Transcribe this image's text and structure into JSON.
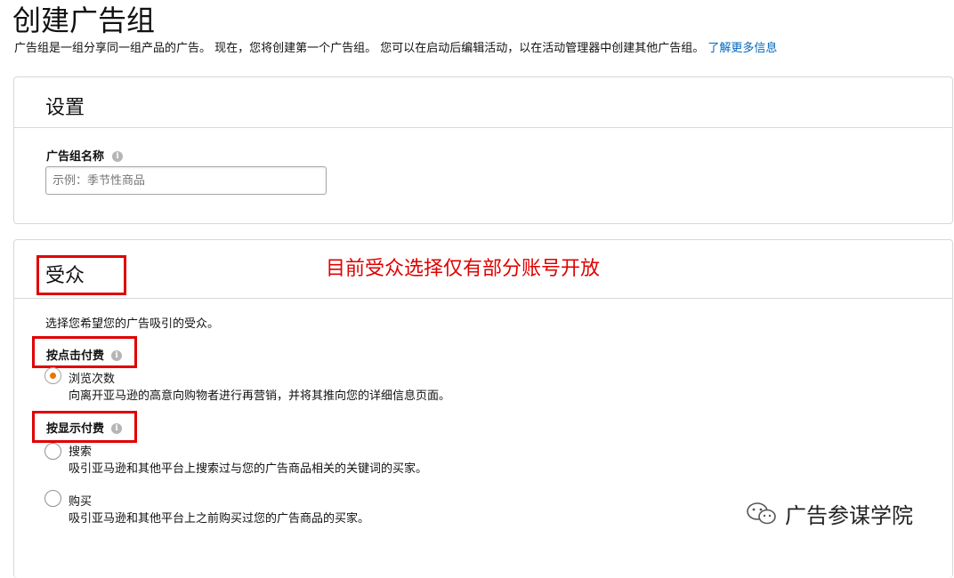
{
  "header": {
    "title": "创建广告组",
    "subtitle": "广告组是一组分享同一组产品的广告。 现在，您将创建第一个广告组。 您可以在启动后编辑活动，以在活动管理器中创建其他广告组。",
    "learn_more": "了解更多信息"
  },
  "settings": {
    "title": "设置",
    "name_label": "广告组名称",
    "name_value": "",
    "name_placeholder": "示例：季节性商品"
  },
  "audience": {
    "title": "受众",
    "annotation": "目前受众选择仅有部分账号开放",
    "prompt": "选择您希望您的广告吸引的受众。",
    "cpc_group": {
      "label": "按点击付费",
      "options": [
        {
          "label": "浏览次数",
          "description": "向离开亚马逊的高意向购物者进行再营销，并将其推向您的详细信息页面。",
          "selected": true
        }
      ]
    },
    "cpm_group": {
      "label": "按显示付费",
      "options": [
        {
          "label": "搜索",
          "description": "吸引亚马逊和其他平台上搜索过与您的广告商品相关的关键词的买家。",
          "selected": false
        },
        {
          "label": "购买",
          "description": "吸引亚马逊和其他平台上之前购买过您的广告商品的买家。",
          "selected": false
        }
      ]
    }
  },
  "info_icon_glyph": "i",
  "watermark": {
    "text": "广告参谋学院",
    "icon": "wechat-icon"
  },
  "colors": {
    "link": "#0066c0",
    "annotation_red": "#e00000",
    "radio_selected": "#e77600",
    "border": "#d5d9d9"
  }
}
